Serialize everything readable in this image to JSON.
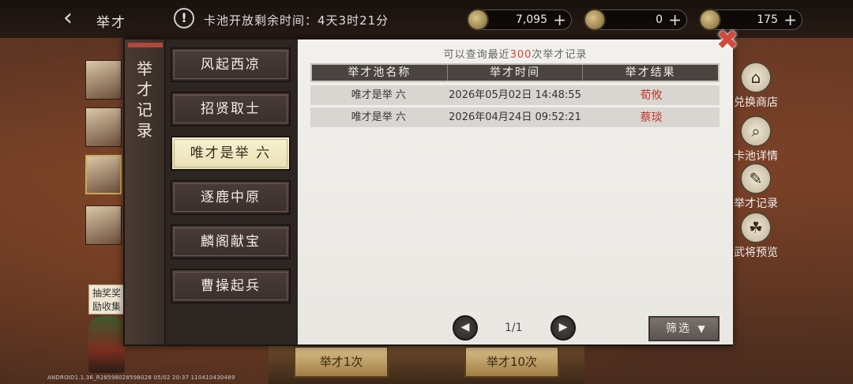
{
  "header": {
    "title": "举才",
    "back_icon": "chevron-left-icon",
    "alert_icon": "exclamation-icon",
    "pool_timer": "卡池开放剩余时间：4天3时21分"
  },
  "resources": [
    {
      "icon": "coin-icon",
      "value": "7,095"
    },
    {
      "icon": "ingot-icon",
      "value": "0"
    },
    {
      "icon": "gem-icon",
      "value": "175"
    }
  ],
  "side_menu": [
    {
      "icon": "shop-icon",
      "label": "兑换商店"
    },
    {
      "icon": "search-icon",
      "label": "卡池详情"
    },
    {
      "icon": "record-icon",
      "label": "举才记录"
    },
    {
      "icon": "preview-icon",
      "label": "武将预览"
    }
  ],
  "lottery_tag": "抽奖奖励收集可",
  "build_info": "ANDROID1.1.36_R28598028598028 05/02 20:37 110410430489",
  "bottom_buttons": [
    "举才1次",
    "举才10次"
  ],
  "modal": {
    "title": "举才记录",
    "close_icon": "close-icon",
    "pools": [
      {
        "label": "风起西凉",
        "active": false
      },
      {
        "label": "招贤取士",
        "active": false
      },
      {
        "label": "唯才是举 六",
        "active": true
      },
      {
        "label": "逐鹿中原",
        "active": false
      },
      {
        "label": "麟阁献宝",
        "active": false
      },
      {
        "label": "曹操起兵",
        "active": false
      }
    ],
    "query_note_prefix": "可以查询最近",
    "query_note_count": "300",
    "query_note_suffix": "次举才记录",
    "columns": [
      "举才池名称",
      "举才时间",
      "举才结果"
    ],
    "rows": [
      {
        "pool": "唯才是举 六",
        "time": "2026年05月02日 14:48:55",
        "result": "荀攸"
      },
      {
        "pool": "唯才是举 六",
        "time": "2026年04月24日 09:52:21",
        "result": "蔡琰"
      }
    ],
    "page_indicator": "1/1",
    "filter_label": "筛选",
    "prev_icon": "arrow-left-icon",
    "next_icon": "arrow-right-icon",
    "filter_icon": "funnel-icon"
  },
  "colors": {
    "accent_red": "#d2473b",
    "active_pool_bg": "#f6f1d2",
    "panel_dark": "#2c2522"
  }
}
